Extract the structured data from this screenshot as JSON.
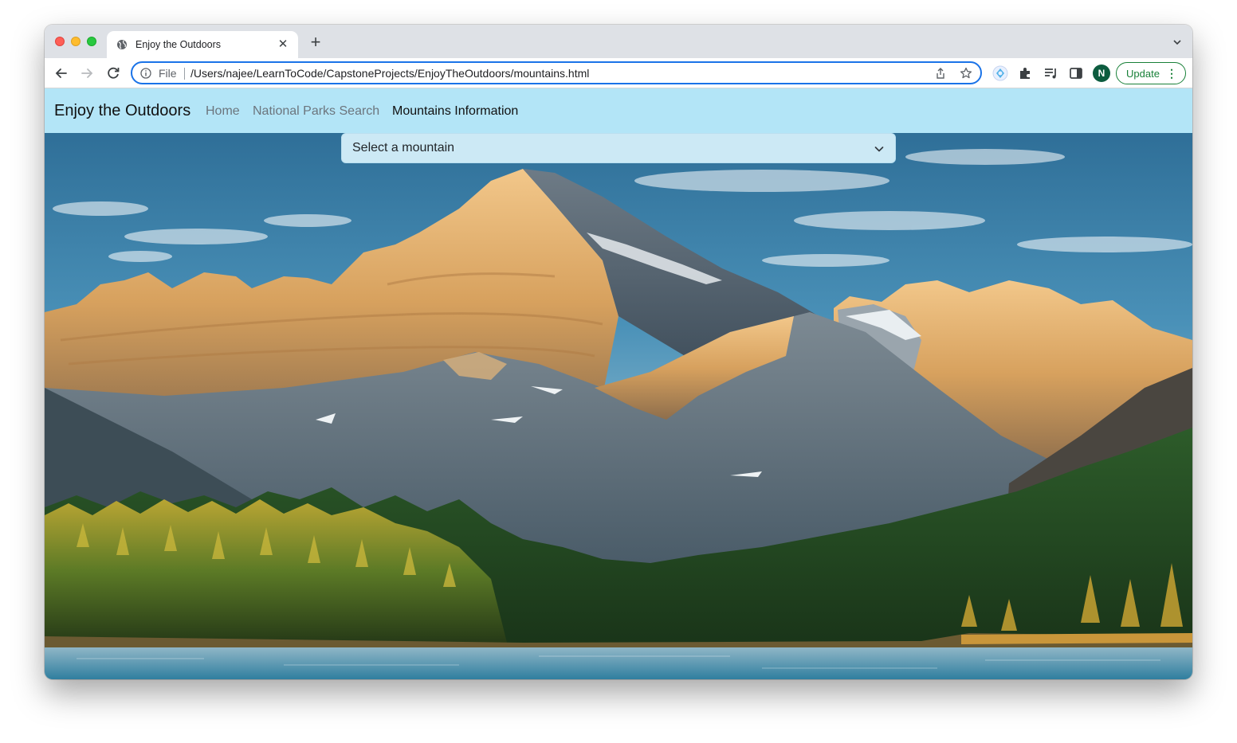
{
  "browser": {
    "tab": {
      "title": "Enjoy the Outdoors",
      "favicon": "globe-icon",
      "close": "✕"
    },
    "new_tab": "+",
    "address_bar": {
      "scheme_label": "File",
      "url": "/Users/najee/LearnToCode/CapstoneProjects/EnjoyTheOutdoors/mountains.html"
    },
    "profile_initial": "N",
    "update_label": "Update",
    "menu_dots": "⋮"
  },
  "site": {
    "brand": "Enjoy the Outdoors",
    "nav": [
      {
        "label": "Home",
        "active": false
      },
      {
        "label": "National Parks Search",
        "active": false
      },
      {
        "label": "Mountains Information",
        "active": true
      }
    ],
    "mountain_select": {
      "selected": "Select a mountain"
    }
  },
  "colors": {
    "navbar_bg": "#b3e5f7",
    "select_bg": "#cce9f5",
    "accent_blue": "#1a73e8",
    "update_green": "#188038"
  }
}
